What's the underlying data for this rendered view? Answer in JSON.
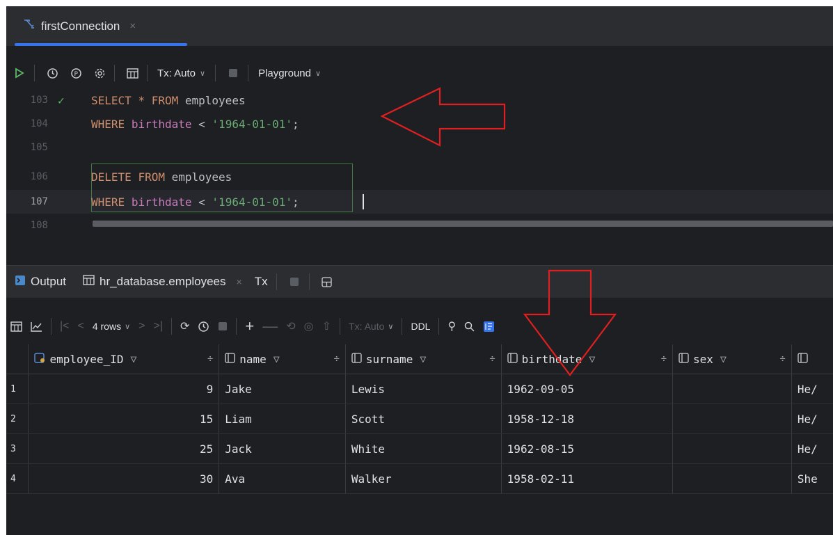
{
  "editor_tab": {
    "title": "firstConnection",
    "close": "×"
  },
  "toolbar": {
    "tx_label": "Tx: Auto",
    "playground_label": "Playground"
  },
  "editor": {
    "lines": [
      {
        "num": "103",
        "parts": [
          {
            "t": "SELECT",
            "c": "kw"
          },
          {
            "t": " ",
            "c": "txt"
          },
          {
            "t": "*",
            "c": "kw"
          },
          {
            "t": " ",
            "c": "txt"
          },
          {
            "t": "FROM",
            "c": "kw"
          },
          {
            "t": " employees",
            "c": "txt"
          }
        ]
      },
      {
        "num": "104",
        "parts": [
          {
            "t": "WHERE",
            "c": "kw"
          },
          {
            "t": " ",
            "c": "txt"
          },
          {
            "t": "birthdate",
            "c": "fld"
          },
          {
            "t": " < ",
            "c": "txt"
          },
          {
            "t": "'1964-01-01'",
            "c": "str"
          },
          {
            "t": ";",
            "c": "txt"
          }
        ]
      },
      {
        "num": "105",
        "parts": []
      },
      {
        "num": "106",
        "parts": [
          {
            "t": "DELETE",
            "c": "kw"
          },
          {
            "t": " ",
            "c": "txt"
          },
          {
            "t": "FROM",
            "c": "kw"
          },
          {
            "t": " employees",
            "c": "txt"
          }
        ]
      },
      {
        "num": "107",
        "parts": [
          {
            "t": "WHERE",
            "c": "kw"
          },
          {
            "t": " ",
            "c": "txt"
          },
          {
            "t": "birthdate",
            "c": "fld"
          },
          {
            "t": " < ",
            "c": "txt"
          },
          {
            "t": "'1964-01-01'",
            "c": "str"
          },
          {
            "t": ";",
            "c": "txt"
          }
        ]
      },
      {
        "num": "108",
        "parts": []
      }
    ]
  },
  "panel_tabs": {
    "output": "Output",
    "results": "hr_database.employees",
    "close": "×",
    "tx": "Tx"
  },
  "results_toolbar": {
    "rows": "4 rows",
    "tx_label": "Tx: Auto",
    "ddl": "DDL"
  },
  "grid": {
    "columns": [
      "employee_ID",
      "name",
      "surname",
      "birthdate",
      "sex"
    ],
    "rows": [
      {
        "n": "1",
        "id": "9",
        "name": "Jake",
        "surname": "Lewis",
        "birthdate": "1962-09-05",
        "sex": "",
        "extra": "He/"
      },
      {
        "n": "2",
        "id": "15",
        "name": "Liam",
        "surname": "Scott",
        "birthdate": "1958-12-18",
        "sex": "",
        "extra": "He/"
      },
      {
        "n": "3",
        "id": "25",
        "name": "Jack",
        "surname": "White",
        "birthdate": "1962-08-15",
        "sex": "",
        "extra": "He/"
      },
      {
        "n": "4",
        "id": "30",
        "name": "Ava",
        "surname": "Walker",
        "birthdate": "1958-02-11",
        "sex": "",
        "extra": "She"
      }
    ]
  },
  "colors": {
    "accent": "#3574f0",
    "annotation": "#e02020"
  }
}
